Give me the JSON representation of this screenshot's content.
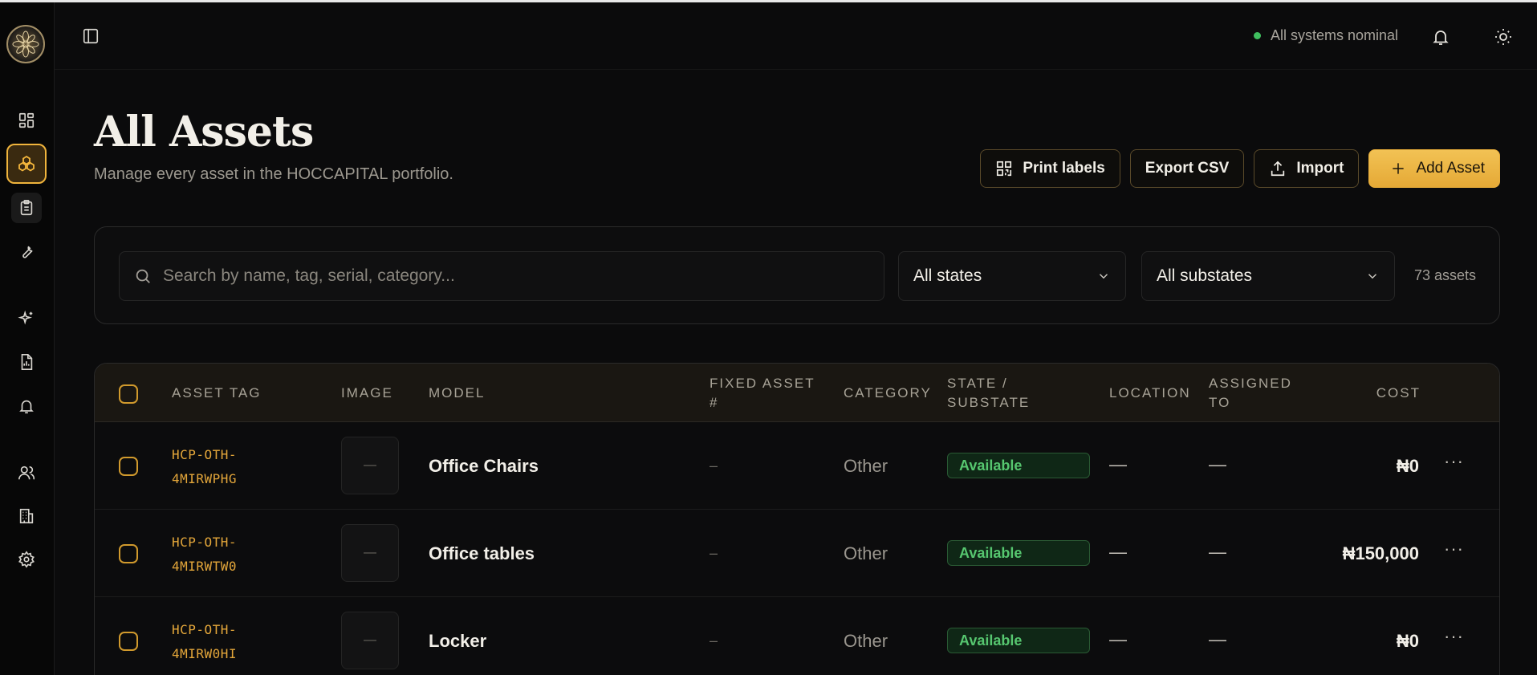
{
  "header": {
    "status_text": "All systems nominal"
  },
  "page": {
    "title": "All Assets",
    "subtitle": "Manage every asset in the HOCCAPITAL portfolio."
  },
  "actions": {
    "print_labels": "Print labels",
    "export_csv": "Export CSV",
    "import": "Import",
    "add_asset": "Add Asset"
  },
  "filters": {
    "search_placeholder": "Search by name, tag, serial, category...",
    "state_selected": "All states",
    "substate_selected": "All substates",
    "count": "73 assets"
  },
  "table": {
    "columns": {
      "asset_tag": "ASSET TAG",
      "image": "IMAGE",
      "model": "MODEL",
      "fixed_asset_1": "FIXED ASSET",
      "fixed_asset_2": "#",
      "category": "CATEGORY",
      "state_1": "STATE /",
      "state_2": "SUBSTATE",
      "location": "LOCATION",
      "assigned_1": "ASSIGNED",
      "assigned_2": "TO",
      "cost": "COST"
    },
    "rows": [
      {
        "tag_1": "HCP-OTH-",
        "tag_2": "4MIRWPHG",
        "image": "—",
        "model": "Office Chairs",
        "fixed_asset": "–",
        "category": "Other",
        "state": "Available",
        "location": "—",
        "assigned_to": "—",
        "cost": "₦0",
        "more": "···"
      },
      {
        "tag_1": "HCP-OTH-",
        "tag_2": "4MIRWTW0",
        "image": "—",
        "model": "Office tables",
        "fixed_asset": "–",
        "category": "Other",
        "state": "Available",
        "location": "—",
        "assigned_to": "—",
        "cost": "₦150,000",
        "more": "···"
      },
      {
        "tag_1": "HCP-OTH-",
        "tag_2": "4MIRW0HI",
        "image": "—",
        "model": "Locker",
        "fixed_asset": "–",
        "category": "Other",
        "state": "Available",
        "location": "—",
        "assigned_to": "—",
        "cost": "₦0",
        "more": "···"
      }
    ]
  },
  "icons": {
    "sidebar": [
      "dashboard-icon",
      "assets-icon",
      "clipboard-icon",
      "wrench-icon",
      "sparkles-icon",
      "report-icon",
      "bell-icon",
      "users-icon",
      "building-icon",
      "settings-icon"
    ]
  },
  "colors": {
    "accent": "#f0b43c",
    "status_green": "#3fbf5f",
    "background": "#0b0b0c"
  }
}
